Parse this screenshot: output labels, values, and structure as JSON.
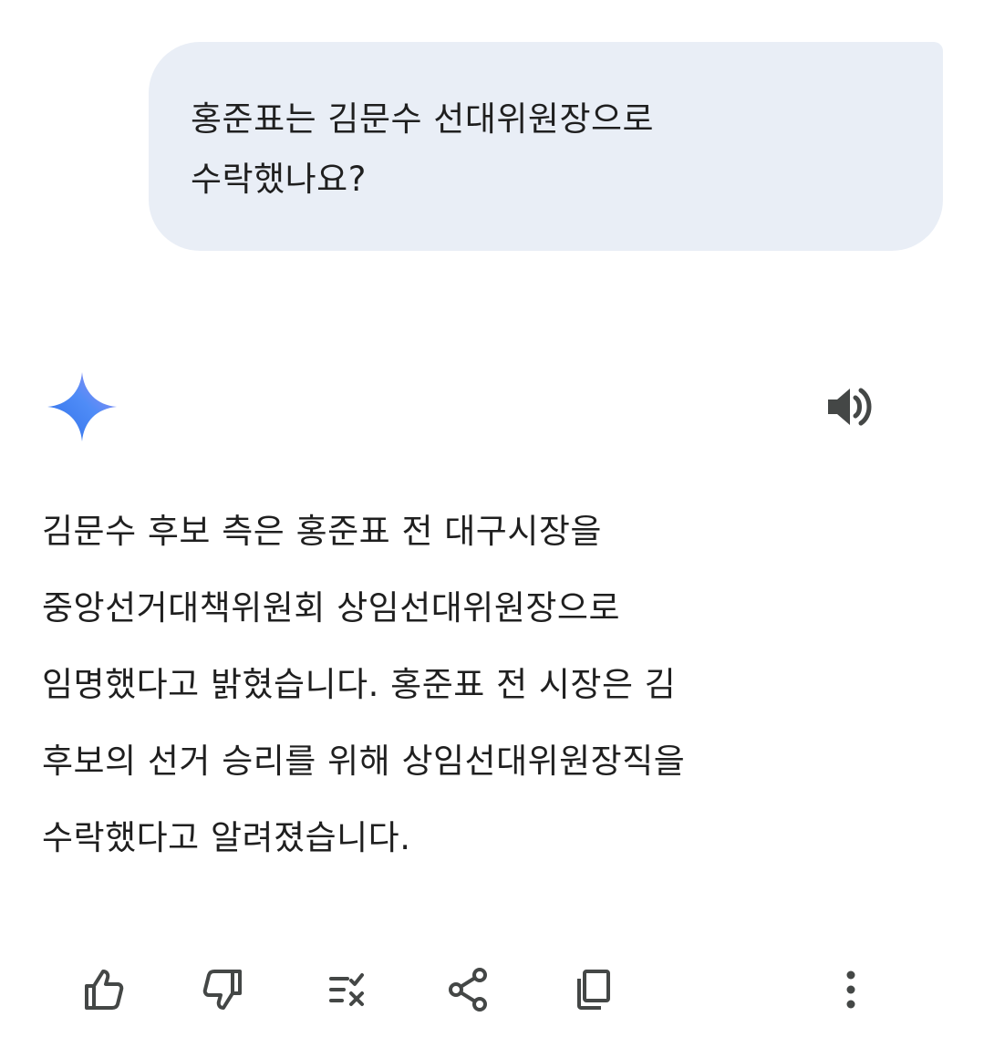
{
  "conversation": {
    "user_message": "홍준표는 김문수 선대위원장으로\n수락했나요?",
    "assistant_response": "김문수 후보 측은 홍준표 전 대구시장을\n중앙선거대책위원회 상임선대위원장으로\n임명했다고 밝혔습니다. 홍준표 전 시장은 김\n후보의 선거 승리를 위해 상임선대위원장직을\n수락했다고 알려졌습니다."
  },
  "icons": {
    "assistant_avatar": "gemini-sparkle-icon",
    "read_aloud": "speaker-icon",
    "actions": [
      "thumbs-up-icon",
      "thumbs-down-icon",
      "modify-response-icon",
      "share-icon",
      "copy-icon",
      "more-vert-icon"
    ]
  },
  "colors": {
    "user_bubble_bg": "#e9eef6",
    "text": "#1f1f1f",
    "icon": "#444746",
    "sparkle_start": "#4f8cf7",
    "sparkle_end": "#8d7ef0"
  }
}
